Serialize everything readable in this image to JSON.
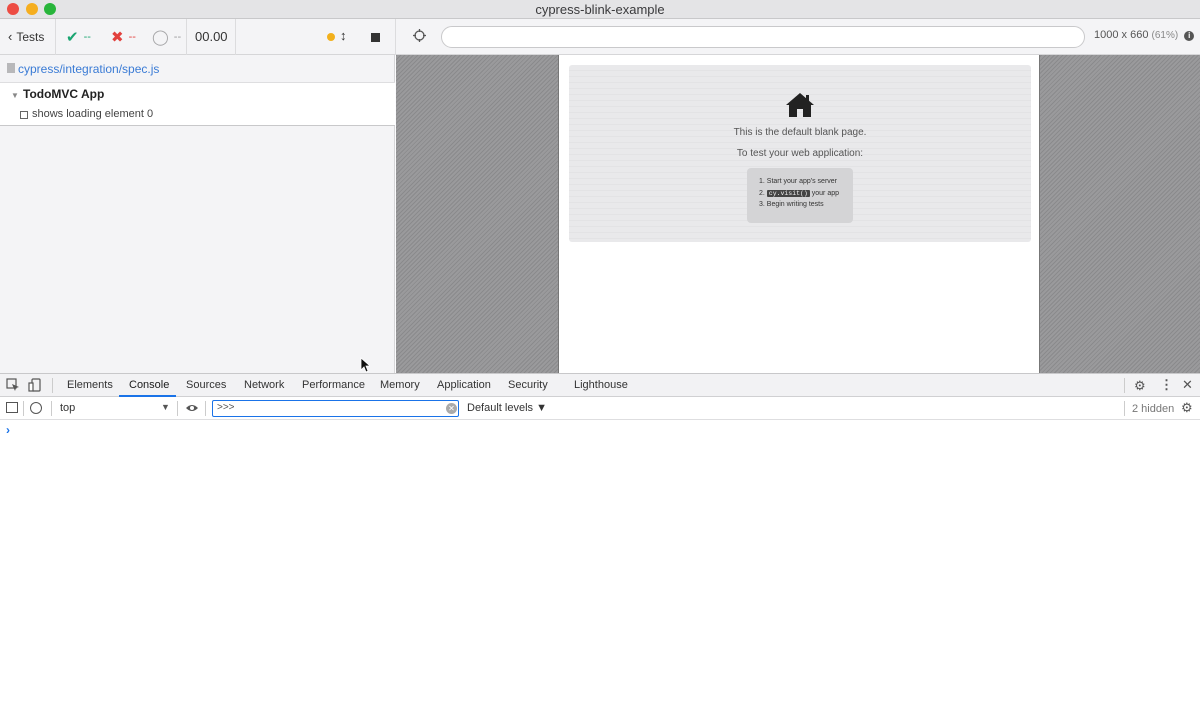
{
  "window": {
    "title": "cypress-blink-example"
  },
  "toolbar": {
    "tests_label": "Tests",
    "passed": "--",
    "failed": "--",
    "pending": "--",
    "duration": "00.00",
    "viewport_size": "1000 x 660",
    "viewport_scale": "(61%)",
    "url": ""
  },
  "reporter": {
    "spec_path": "cypress/integration/spec.js",
    "suite_title": "TodoMVC App",
    "test_title": "shows loading element 0"
  },
  "app": {
    "message_1": "This is the default blank page.",
    "message_2": "To test your web application:",
    "steps": [
      {
        "num": "1.",
        "text": "Start your app's server"
      },
      {
        "num": "2.",
        "code": "cy.visit()",
        "text": "your app"
      },
      {
        "num": "3.",
        "text": "Begin writing tests"
      }
    ]
  },
  "devtools": {
    "tabs": [
      "Elements",
      "Console",
      "Sources",
      "Network",
      "Performance",
      "Memory",
      "Application",
      "Security",
      "Lighthouse"
    ],
    "active_tab": "Console",
    "context": "top",
    "filter_value": ">>>",
    "levels": "Default levels ▼",
    "hidden_count": "2 hidden",
    "prompt": "›"
  },
  "colors": {
    "pass": "#1aa571",
    "fail": "#e2403d",
    "running": "#f2b01c",
    "link": "#3a7bd5",
    "devtools_accent": "#1a73e8"
  }
}
